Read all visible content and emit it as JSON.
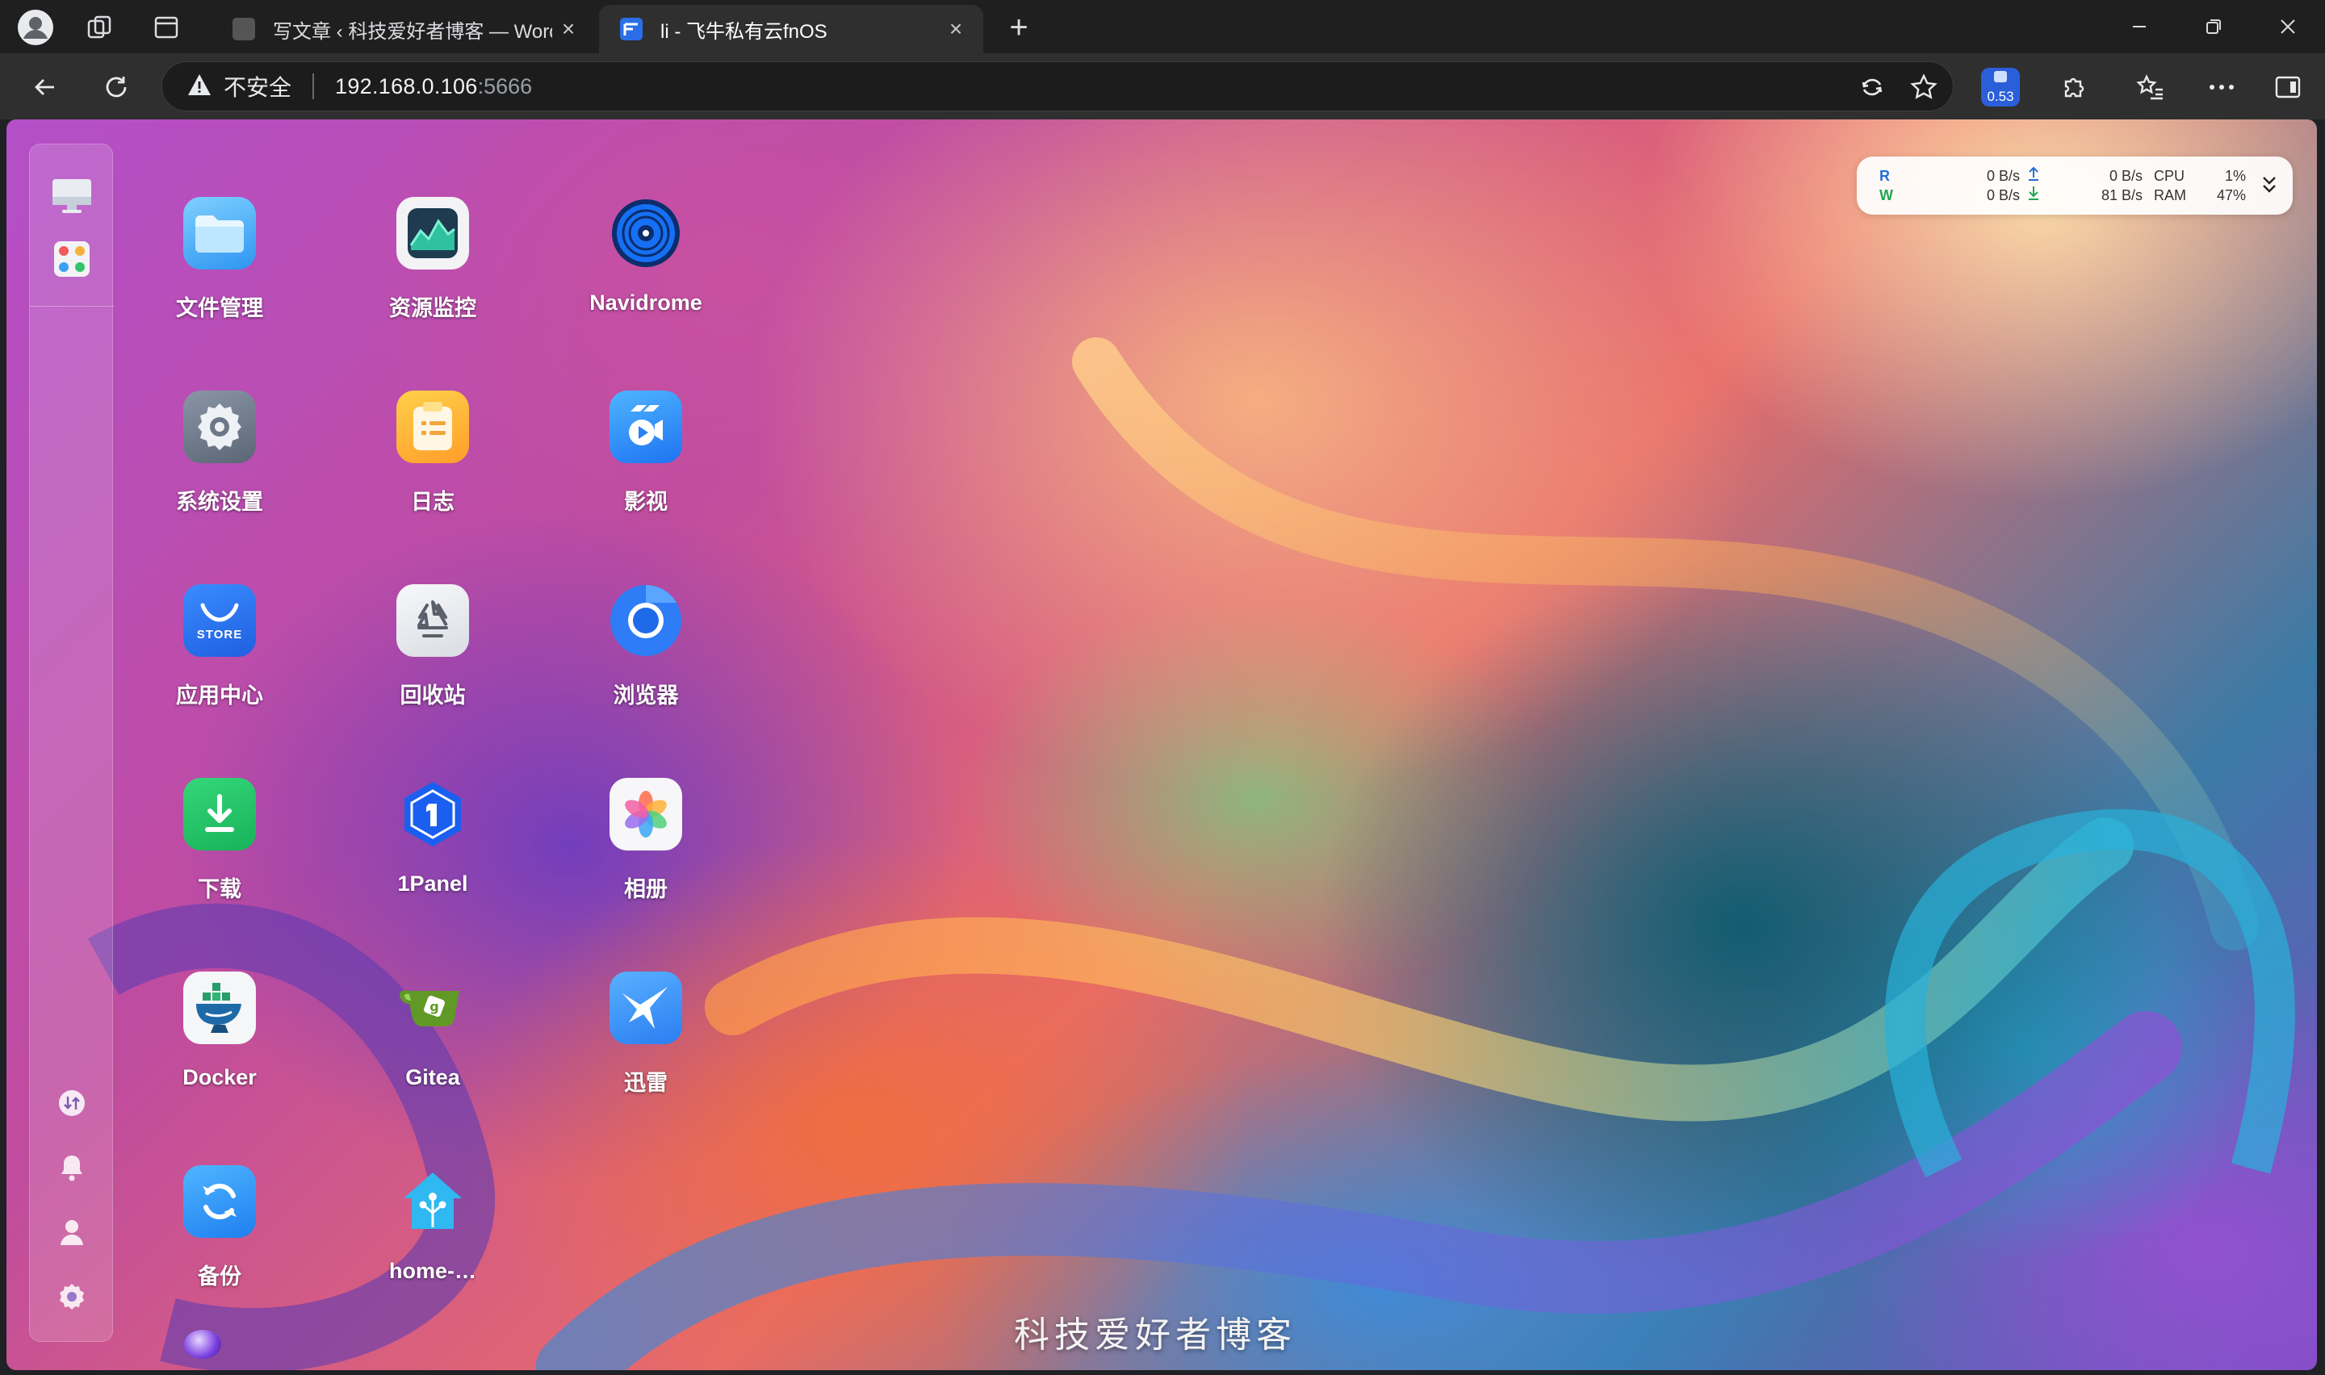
{
  "tabs": [
    {
      "title": "写文章 ‹ 科技爱好者博客 — WordPress",
      "active": false
    },
    {
      "title": "li - 飞牛私有云fnOS",
      "active": true
    }
  ],
  "new_tab_symbol": "+",
  "close_symbol": "×",
  "address": {
    "security_label": "不安全",
    "host": "192.168.0.106",
    "port": ":5666"
  },
  "toolbar": {
    "extension_badge": "0.53"
  },
  "dock": {
    "top_items": [
      "monitor-icon",
      "app-grid-icon"
    ],
    "bottom_items": [
      "transfer-icon",
      "bell-icon",
      "user-icon",
      "gear-icon"
    ]
  },
  "apps": [
    {
      "label": "文件管理",
      "icon": "folder-icon"
    },
    {
      "label": "资源监控",
      "icon": "resource-monitor-icon"
    },
    {
      "label": "Navidrome",
      "icon": "vinyl-icon"
    },
    {
      "label": "系统设置",
      "icon": "settings-gear-icon"
    },
    {
      "label": "日志",
      "icon": "clipboard-icon"
    },
    {
      "label": "影视",
      "icon": "video-icon"
    },
    {
      "label": "应用中心",
      "icon": "store-icon",
      "sublabel": "STORE"
    },
    {
      "label": "回收站",
      "icon": "recycle-icon"
    },
    {
      "label": "浏览器",
      "icon": "browser-icon"
    },
    {
      "label": "下载",
      "icon": "download-icon"
    },
    {
      "label": "1Panel",
      "icon": "1panel-icon"
    },
    {
      "label": "相册",
      "icon": "photos-icon"
    },
    {
      "label": "Docker",
      "icon": "docker-icon"
    },
    {
      "label": "Gitea",
      "icon": "gitea-icon"
    },
    {
      "label": "迅雷",
      "icon": "xunlei-icon"
    },
    {
      "label": "备份",
      "icon": "backup-icon"
    },
    {
      "label": "home-…",
      "icon": "home-assistant-icon"
    }
  ],
  "widget": {
    "r_label": "R",
    "w_label": "W",
    "disk_read": "0 B/s",
    "disk_write": "0 B/s",
    "net_up": "0 B/s",
    "net_down": "81 B/s",
    "cpu_label": "CPU",
    "ram_label": "RAM",
    "cpu_value": "1%",
    "ram_value": "47%"
  },
  "watermark": "科技爱好者博客",
  "colors": {
    "accent_blue": "#1e6fd9",
    "accent_green": "#1ea74f",
    "titlebar": "#1f1f1f",
    "toolbar": "#2f2f2f"
  }
}
